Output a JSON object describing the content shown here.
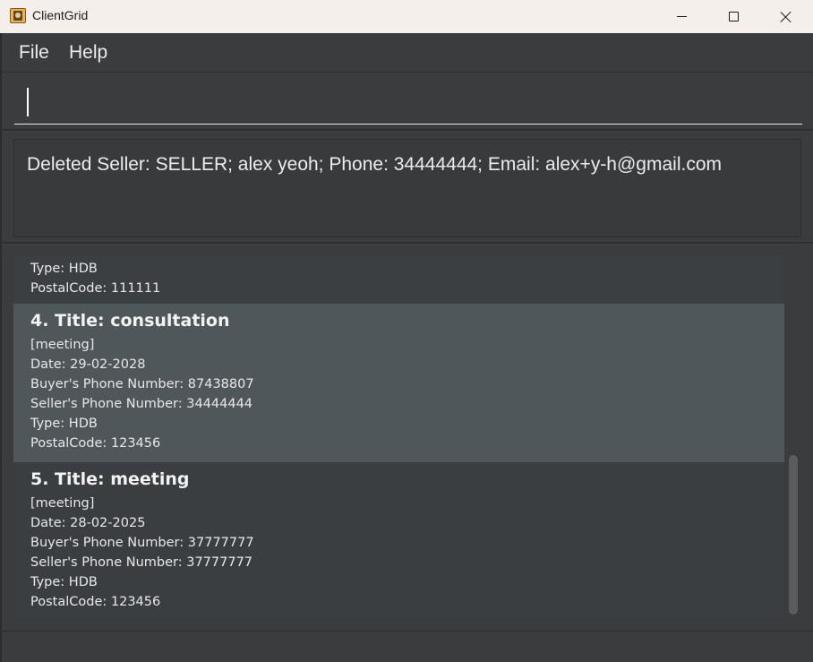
{
  "window": {
    "title": "ClientGrid",
    "icon": "address-book-icon"
  },
  "menu": {
    "items": [
      "File",
      "Help"
    ]
  },
  "command": {
    "value": "",
    "placeholder": ""
  },
  "result": {
    "message": "Deleted Seller: SELLER; alex yeoh; Phone: 34444444; Email: alex+y-h@gmail.com"
  },
  "list": {
    "partial_card": {
      "type": "Type: HDB",
      "postal": "PostalCode: 111111"
    },
    "cards": [
      {
        "title": "4. Title: consultation",
        "tag": "[meeting]",
        "date": "Date: 29-02-2028",
        "buyer_phone": "Buyer's Phone Number: 87438807",
        "seller_phone": "Seller's Phone Number: 34444444",
        "type": "Type: HDB",
        "postal": "PostalCode: 123456"
      },
      {
        "title": "5. Title: meeting",
        "tag": "[meeting]",
        "date": "Date: 28-02-2025",
        "buyer_phone": "Buyer's Phone Number: 37777777",
        "seller_phone": "Seller's Phone Number: 37777777",
        "type": "Type: HDB",
        "postal": "PostalCode: 123456"
      }
    ]
  },
  "colors": {
    "background": "#3b3c3e",
    "selected_card": "#50575b",
    "titlebar": "#f5efec",
    "text": "#e6e6e6"
  }
}
